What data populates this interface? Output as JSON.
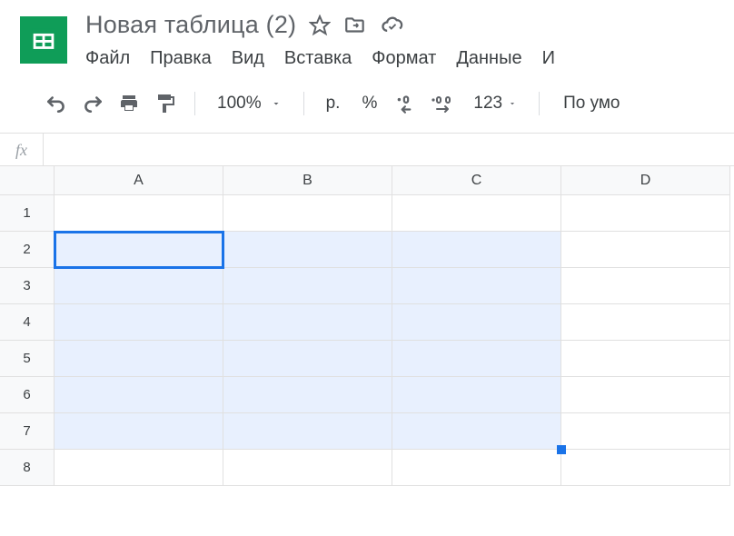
{
  "header": {
    "title": "Новая таблица (2)"
  },
  "menu": {
    "file": "Файл",
    "edit": "Правка",
    "view": "Вид",
    "insert": "Вставка",
    "format": "Формат",
    "data": "Данные",
    "tools_partial": "И"
  },
  "toolbar": {
    "zoom": "100%",
    "currency": "р.",
    "percent": "%",
    "dec_decrease": ".0",
    "dec_increase": ".00",
    "format123": "123",
    "font_partial": "По умо"
  },
  "formula": {
    "fx": "fx"
  },
  "grid": {
    "cols": [
      "A",
      "B",
      "C",
      "D"
    ],
    "rows": [
      "1",
      "2",
      "3",
      "4",
      "5",
      "6",
      "7",
      "8"
    ],
    "selection": {
      "startRow": 2,
      "endRow": 7,
      "startCol": 1,
      "endCol": 3,
      "activeRow": 2,
      "activeCol": 1
    }
  }
}
